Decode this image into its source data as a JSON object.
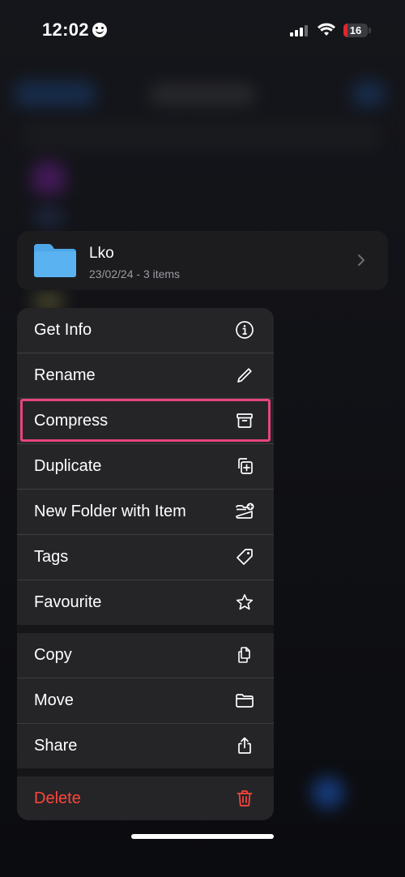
{
  "status_bar": {
    "time": "12:02",
    "battery": "16",
    "battery_level": 0.16
  },
  "folder": {
    "name": "Lko",
    "meta": "23/02/24 - 3 items"
  },
  "menu": {
    "items": [
      {
        "label": "Get Info",
        "icon": "info-icon"
      },
      {
        "label": "Rename",
        "icon": "pencil-icon"
      },
      {
        "label": "Compress",
        "icon": "archive-box-icon"
      },
      {
        "label": "Duplicate",
        "icon": "duplicate-icon"
      },
      {
        "label": "New Folder with Item",
        "icon": "folder-plus-icon"
      },
      {
        "label": "Tags",
        "icon": "tag-icon"
      },
      {
        "label": "Favourite",
        "icon": "star-icon"
      },
      {
        "label": "Copy",
        "icon": "copy-icon"
      },
      {
        "label": "Move",
        "icon": "folder-icon"
      },
      {
        "label": "Share",
        "icon": "share-icon"
      },
      {
        "label": "Delete",
        "icon": "trash-icon"
      }
    ]
  },
  "colors": {
    "accent": "#e6457a",
    "destructive": "#ff453a",
    "folder_blue": "#5ab2f0"
  }
}
